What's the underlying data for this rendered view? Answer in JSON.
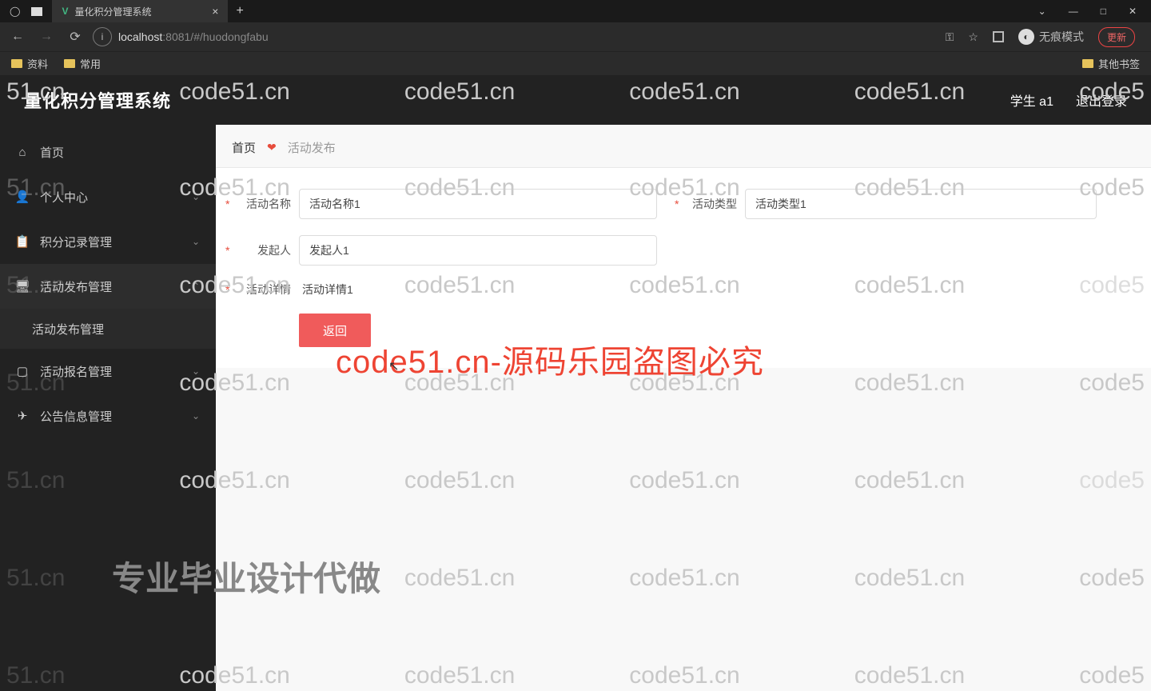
{
  "browser": {
    "tab_title": "量化积分管理系统",
    "url_host": "localhost",
    "url_path": ":8081/#/huodongfabu",
    "incognito_label": "无痕模式",
    "update_label": "更新",
    "bookmarks": [
      "资料",
      "常用"
    ],
    "other_bookmarks": "其他书签"
  },
  "header": {
    "title": "量化积分管理系统",
    "user": "学生 a1",
    "logout": "退出登录"
  },
  "sidebar": {
    "items": [
      {
        "label": "首页"
      },
      {
        "label": "个人中心"
      },
      {
        "label": "积分记录管理"
      },
      {
        "label": "活动发布管理"
      },
      {
        "label": "活动报名管理"
      },
      {
        "label": "公告信息管理"
      }
    ],
    "sub_active": "活动发布管理"
  },
  "crumb": {
    "home": "首页",
    "current": "活动发布"
  },
  "form": {
    "name_label": "活动名称",
    "name_value": "活动名称1",
    "type_label": "活动类型",
    "type_value": "活动类型1",
    "initiator_label": "发起人",
    "initiator_value": "发起人1",
    "detail_label": "活动详情",
    "detail_value": "活动详情1",
    "back_btn": "返回"
  },
  "watermark": {
    "small": "code51.cn",
    "big": "code51.cn-源码乐园盗图必究",
    "pro": "专业毕业设计代做"
  }
}
